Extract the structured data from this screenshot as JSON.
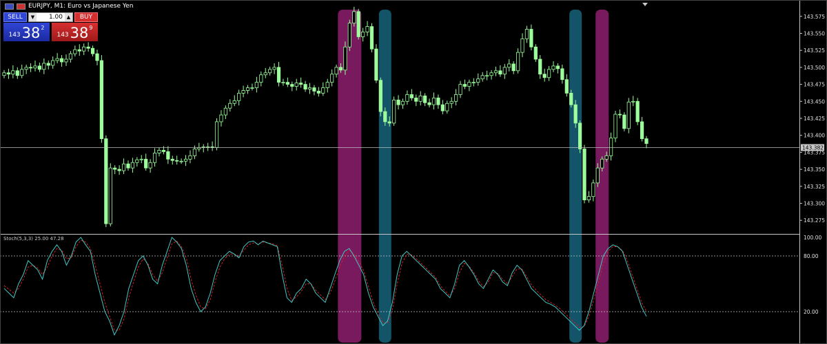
{
  "header": {
    "symbol_title": "EURJPY, M1:  Euro vs Japanese Yen"
  },
  "trade_panel": {
    "sell_label": "SELL",
    "buy_label": "BUY",
    "lot_value": "1.00",
    "lot_down_glyph": "▼",
    "lot_up_glyph": "▲",
    "sell_price": {
      "prefix": "143",
      "big": "38",
      "sup": "2"
    },
    "buy_price": {
      "prefix": "143",
      "big": "38",
      "sup": "9"
    }
  },
  "stochastic": {
    "label": "Stoch(5,3,3) 25.00 47.28"
  },
  "colors": {
    "background": "#000000",
    "candle": "#9cff9c",
    "stoch_main": "#40c8c8",
    "stoch_signal": "#d02020",
    "highlight_magenta": "#7a1a5e",
    "highlight_teal": "#135468"
  },
  "chart_data": [
    {
      "type": "candlestick",
      "yticks": [
        "143.575",
        "143.550",
        "143.525",
        "143.500",
        "143.475",
        "143.450",
        "143.425",
        "143.400",
        "143.375",
        "143.350",
        "143.325",
        "143.300",
        "143.275"
      ],
      "ylim": [
        143.255,
        143.595
      ],
      "current_price": "143.382",
      "closes": [
        143.492,
        143.49,
        143.495,
        143.488,
        143.497,
        143.5,
        143.499,
        143.502,
        143.497,
        143.506,
        143.503,
        143.51,
        143.513,
        143.508,
        143.512,
        143.52,
        143.526,
        143.524,
        143.53,
        143.528,
        143.52,
        143.51,
        143.395,
        143.27,
        143.352,
        143.35,
        143.348,
        143.358,
        143.352,
        143.36,
        143.364,
        143.365,
        143.352,
        143.36,
        143.374,
        143.378,
        143.376,
        143.365,
        143.363,
        143.362,
        143.362,
        143.365,
        143.37,
        143.38,
        143.382,
        143.383,
        143.383,
        143.382,
        143.42,
        143.43,
        143.44,
        143.447,
        143.451,
        143.462,
        143.466,
        143.47,
        143.47,
        143.478,
        143.489,
        143.492,
        143.497,
        143.5,
        143.478,
        143.478,
        143.475,
        143.472,
        143.477,
        143.475,
        143.468,
        143.47,
        143.465,
        143.462,
        143.47,
        143.478,
        143.49,
        143.5,
        143.496,
        143.53,
        143.565,
        143.582,
        143.545,
        143.552,
        143.56,
        143.527,
        143.481,
        143.435,
        143.42,
        143.418,
        143.452,
        143.445,
        143.45,
        143.46,
        143.455,
        143.45,
        143.458,
        143.448,
        143.445,
        143.455,
        143.445,
        143.436,
        143.447,
        143.45,
        143.46,
        143.475,
        143.472,
        143.478,
        143.478,
        143.483,
        143.488,
        143.488,
        143.492,
        143.495,
        143.49,
        143.5,
        143.505,
        143.495,
        143.522,
        143.542,
        143.556,
        143.53,
        143.512,
        143.49,
        143.485,
        143.497,
        143.502,
        143.498,
        143.482,
        143.462,
        143.445,
        143.418,
        143.38,
        143.305,
        143.31,
        143.33,
        143.352,
        143.365,
        143.37,
        143.396,
        143.431,
        143.43,
        143.41,
        143.449,
        143.45,
        143.42,
        143.395,
        143.388
      ],
      "highlight_bands": [
        {
          "color": "magenta",
          "x_index": 78
        },
        {
          "color": "teal",
          "x_index": 86
        },
        {
          "color": "teal",
          "x_index": 129
        },
        {
          "color": "magenta",
          "x_index": 135
        }
      ]
    },
    {
      "type": "line",
      "title": "Stoch(5,3,3) 25.00 47.28",
      "yticks": [
        "100.00",
        "80.00",
        "20.00"
      ],
      "ylim": [
        0,
        100
      ],
      "levels": [
        80,
        20
      ],
      "series": [
        {
          "values": [
            45,
            40,
            35,
            50,
            60,
            75,
            70,
            65,
            55,
            75,
            85,
            92,
            85,
            70,
            80,
            95,
            100,
            92,
            85,
            60,
            40,
            20,
            10,
            -5,
            5,
            20,
            45,
            60,
            75,
            80,
            70,
            55,
            50,
            70,
            85,
            100,
            95,
            88,
            70,
            45,
            30,
            20,
            25,
            40,
            60,
            75,
            80,
            85,
            82,
            78,
            90,
            95,
            96,
            92,
            96,
            94,
            92,
            90,
            60,
            35,
            30,
            40,
            45,
            55,
            50,
            40,
            35,
            30,
            45,
            60,
            75,
            85,
            88,
            80,
            70,
            60,
            40,
            25,
            15,
            5,
            10,
            30,
            60,
            80,
            85,
            80,
            75,
            70,
            65,
            60,
            55,
            45,
            40,
            35,
            50,
            70,
            75,
            68,
            60,
            50,
            45,
            55,
            65,
            60,
            52,
            48,
            62,
            70,
            65,
            55,
            45,
            40,
            35,
            30,
            28,
            25,
            20,
            15,
            10,
            5,
            0,
            5,
            20,
            40,
            60,
            80,
            88,
            92,
            90,
            85,
            70,
            55,
            40,
            25,
            15
          ]
        },
        {
          "values": [
            48,
            44,
            40,
            45,
            55,
            68,
            70,
            67,
            60,
            68,
            80,
            88,
            86,
            77,
            78,
            90,
            97,
            95,
            88,
            70,
            50,
            30,
            15,
            0,
            0,
            12,
            35,
            52,
            68,
            77,
            72,
            60,
            53,
            62,
            78,
            93,
            96,
            90,
            78,
            55,
            38,
            25,
            23,
            33,
            52,
            68,
            77,
            82,
            82,
            80,
            86,
            92,
            94,
            93,
            95,
            94,
            93,
            91,
            70,
            45,
            32,
            36,
            42,
            50,
            50,
            43,
            38,
            33,
            40,
            53,
            68,
            80,
            86,
            82,
            74,
            64,
            47,
            30,
            18,
            8,
            8,
            22,
            50,
            72,
            82,
            81,
            77,
            72,
            67,
            62,
            57,
            48,
            42,
            37,
            45,
            62,
            72,
            69,
            62,
            53,
            47,
            52,
            62,
            61,
            55,
            50,
            58,
            66,
            66,
            58,
            49,
            43,
            38,
            33,
            30,
            27,
            23,
            18,
            13,
            8,
            3,
            4,
            15,
            33,
            52,
            72,
            85,
            90,
            90,
            86,
            75,
            60,
            45,
            30,
            20
          ]
        }
      ]
    }
  ]
}
